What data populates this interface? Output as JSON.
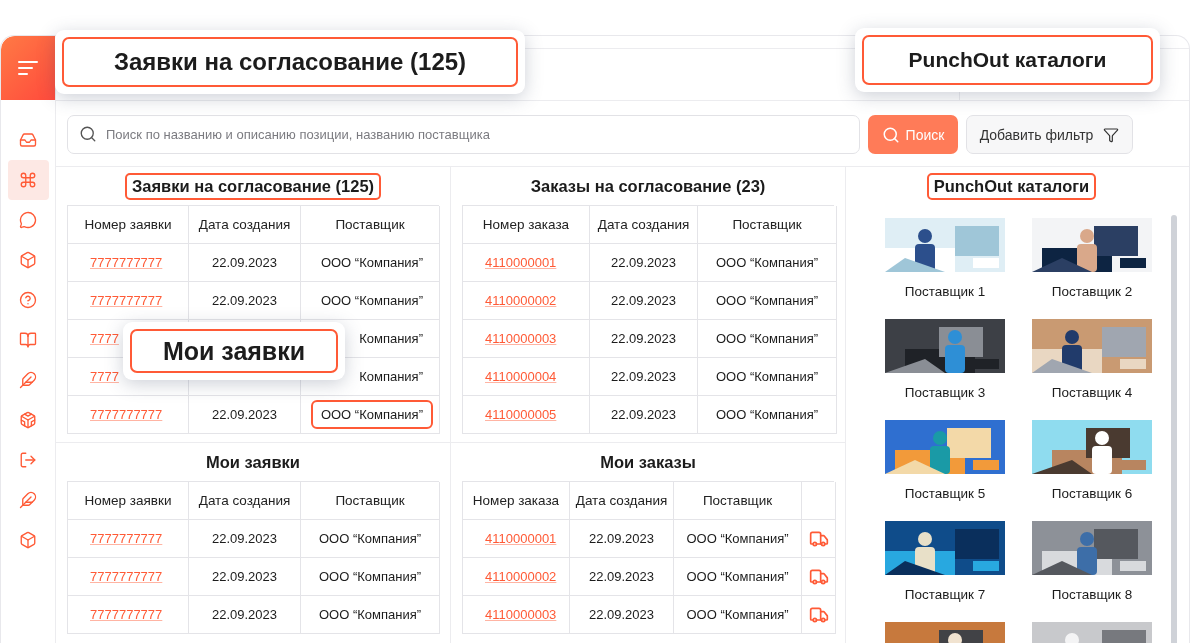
{
  "sidebar": {
    "items": [
      {
        "selected": false
      },
      {
        "selected": true
      },
      {
        "selected": false
      },
      {
        "selected": false
      },
      {
        "selected": false
      },
      {
        "selected": false
      },
      {
        "selected": false
      },
      {
        "selected": false
      },
      {
        "selected": false
      },
      {
        "selected": false
      },
      {
        "selected": false
      }
    ]
  },
  "search": {
    "placeholder": "Поиск по названию и описанию позиции, названию поставщика",
    "button": "Поиск",
    "filter_button": "Добавить фильтр"
  },
  "panels": [
    {
      "title": "Заявки на согласование (125)",
      "highlighted": true,
      "delivery_column": false,
      "columns": [
        "Номер заявки",
        "Дата создания",
        "Поставщик"
      ],
      "rows": [
        {
          "number": "7777777777",
          "date": "22.09.2023",
          "supplier": "ООО “Компания”",
          "supplier_highlighted": false
        },
        {
          "number": "7777777777",
          "date": "22.09.2023",
          "supplier": "ООО “Компания”",
          "supplier_highlighted": false
        },
        {
          "number": "7777",
          "supplier": "Компания”",
          "supplier_highlighted": false
        },
        {
          "number": "7777",
          "supplier": "Компания”",
          "supplier_highlighted": false
        },
        {
          "number": "7777777777",
          "date": "22.09.2023",
          "supplier": "ООО “Компания”",
          "supplier_highlighted": true
        }
      ]
    },
    {
      "title": "Заказы на согласование (23)",
      "highlighted": false,
      "delivery_column": false,
      "columns": [
        "Номер заказа",
        "Дата создания",
        "Поставщик"
      ],
      "rows": [
        {
          "number": "4110000001",
          "date": "22.09.2023",
          "supplier": "ООО “Компания”",
          "supplier_highlighted": false
        },
        {
          "number": "4110000002",
          "date": "22.09.2023",
          "supplier": "ООО “Компания”",
          "supplier_highlighted": false
        },
        {
          "number": "4110000003",
          "date": "22.09.2023",
          "supplier": "ООО “Компания”",
          "supplier_highlighted": false
        },
        {
          "number": "4110000004",
          "date": "22.09.2023",
          "supplier": "ООО “Компания”",
          "supplier_highlighted": false
        },
        {
          "number": "4110000005",
          "date": "22.09.2023",
          "supplier": "ООО “Компания”",
          "supplier_highlighted": false
        }
      ]
    },
    {
      "title": "Мои заявки",
      "highlighted": false,
      "delivery_column": false,
      "columns": [
        "Номер заявки",
        "Дата создания",
        "Поставщик"
      ],
      "rows": [
        {
          "number": "7777777777",
          "date": "22.09.2023",
          "supplier": "ООО “Компания”",
          "supplier_highlighted": false
        },
        {
          "number": "7777777777",
          "date": "22.09.2023",
          "supplier": "ООО “Компания”",
          "supplier_highlighted": false
        },
        {
          "number": "7777777777",
          "date": "22.09.2023",
          "supplier": "ООО “Компания”",
          "supplier_highlighted": false
        }
      ]
    },
    {
      "title": "Мои заказы",
      "highlighted": false,
      "delivery_column": true,
      "columns": [
        "Номер заказа",
        "Дата создания",
        "Поставщик"
      ],
      "rows": [
        {
          "number": "4110000001",
          "date": "22.09.2023",
          "supplier": "ООО “Компания”",
          "supplier_highlighted": false
        },
        {
          "number": "4110000002",
          "date": "22.09.2023",
          "supplier": "ООО “Компания”",
          "supplier_highlighted": false
        },
        {
          "number": "4110000003",
          "date": "22.09.2023",
          "supplier": "ООО “Компания”",
          "supplier_highlighted": false
        }
      ]
    }
  ],
  "catalog": {
    "title": "PunchOut каталоги",
    "highlighted": true,
    "items": [
      {
        "kind": "picture",
        "name": "Поставщик 1"
      },
      {
        "kind": "picture",
        "name": "Поставщик 2"
      },
      {
        "kind": "picture",
        "name": "Поставщик 3"
      },
      {
        "kind": "picture",
        "name": "Поставщик 4"
      },
      {
        "kind": "picture",
        "name": "Поставщик 5"
      },
      {
        "kind": "picture",
        "name": "Поставщик 6"
      },
      {
        "kind": "picture",
        "name": "Поставщик 7"
      },
      {
        "kind": "picture",
        "name": "Поставщик 8"
      },
      {
        "kind": "picture"
      },
      {
        "kind": "picture"
      }
    ]
  },
  "callouts": [
    {
      "text": "Заявки на согласование (125)"
    },
    {
      "text": "PunchOut каталоги"
    },
    {
      "text": "Мои заявки"
    }
  ]
}
